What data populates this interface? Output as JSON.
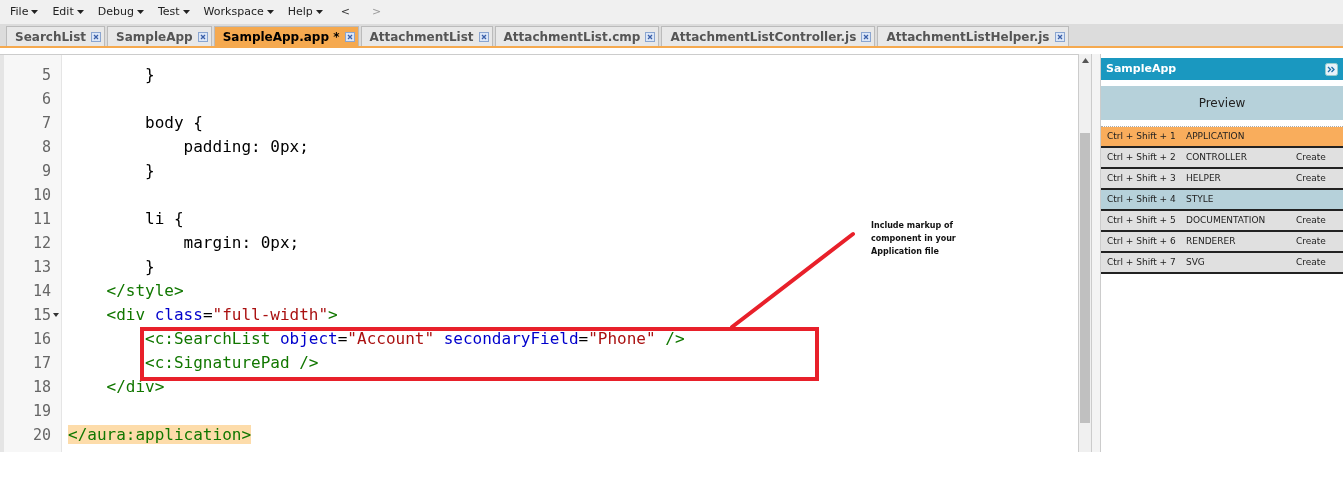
{
  "menu": [
    "File",
    "Edit",
    "Debug",
    "Test",
    "Workspace",
    "Help"
  ],
  "nav": [
    "<",
    ">"
  ],
  "tabs": [
    {
      "label": "SearchList",
      "selected": false
    },
    {
      "label": "SampleApp",
      "selected": false
    },
    {
      "label": "SampleApp.app *",
      "selected": true
    },
    {
      "label": "AttachmentList",
      "selected": false
    },
    {
      "label": "AttachmentList.cmp",
      "selected": false
    },
    {
      "label": "AttachmentListController.js",
      "selected": false
    },
    {
      "label": "AttachmentListHelper.js",
      "selected": false
    }
  ],
  "editor": {
    "lines": [
      {
        "number": "5",
        "fold": false,
        "tokens": [
          {
            "kind": "plain",
            "text": "        }"
          }
        ]
      },
      {
        "number": "6",
        "fold": false
      },
      {
        "number": "7",
        "fold": false,
        "tokens": [
          {
            "kind": "plain",
            "text": "        body {"
          }
        ]
      },
      {
        "number": "8",
        "fold": false,
        "tokens": [
          {
            "kind": "plain",
            "text": "            padding: 0px;"
          }
        ]
      },
      {
        "number": "9",
        "fold": false,
        "tokens": [
          {
            "kind": "plain",
            "text": "        }"
          }
        ]
      },
      {
        "number": "10",
        "fold": false
      },
      {
        "number": "11",
        "fold": false,
        "tokens": [
          {
            "kind": "plain",
            "text": "        li {"
          }
        ]
      },
      {
        "number": "12",
        "fold": false,
        "tokens": [
          {
            "kind": "plain",
            "text": "            margin: 0px;"
          }
        ]
      },
      {
        "number": "13",
        "fold": false,
        "tokens": [
          {
            "kind": "plain",
            "text": "        }"
          }
        ]
      },
      {
        "number": "14",
        "fold": false,
        "tokens": [
          {
            "kind": "tag",
            "text": "    </style>"
          }
        ]
      },
      {
        "number": "15",
        "fold": true,
        "tokens": [
          {
            "kind": "tag",
            "text": "    <div "
          },
          {
            "kind": "attr",
            "text": "class"
          },
          {
            "kind": "plain",
            "text": "="
          },
          {
            "kind": "string",
            "text": "\"full-width\""
          },
          {
            "kind": "tag",
            "text": ">"
          }
        ]
      },
      {
        "number": "16",
        "fold": false,
        "tokens": [
          {
            "kind": "tag",
            "text": "        <c:SearchList "
          },
          {
            "kind": "attr",
            "text": "object"
          },
          {
            "kind": "plain",
            "text": "="
          },
          {
            "kind": "string",
            "text": "\"Account\""
          },
          {
            "kind": "attr",
            "text": " secondaryField"
          },
          {
            "kind": "plain",
            "text": "="
          },
          {
            "kind": "string",
            "text": "\"Phone\""
          },
          {
            "kind": "tag",
            "text": " />"
          }
        ]
      },
      {
        "number": "17",
        "fold": false,
        "tokens": [
          {
            "kind": "tag",
            "text": "        <c:SignaturePad />"
          }
        ]
      },
      {
        "number": "18",
        "fold": false,
        "tokens": [
          {
            "kind": "tag",
            "text": "    </div>"
          }
        ]
      },
      {
        "number": "19",
        "fold": false
      },
      {
        "number": "20",
        "fold": false,
        "tokens": [
          {
            "kind": "match",
            "text": "</aura:application>"
          }
        ]
      }
    ]
  },
  "annotation": {
    "text": "Include markup of component in your Application file"
  },
  "panel": {
    "title": "SampleApp",
    "preview": "Preview",
    "rows": [
      {
        "shortcut": "Ctrl + Shift + 1",
        "name": "APPLICATION",
        "kind": "current"
      },
      {
        "shortcut": "Ctrl + Shift + 2",
        "name": "CONTROLLER",
        "kind": "missing",
        "action": "Create"
      },
      {
        "shortcut": "Ctrl + Shift + 3",
        "name": "HELPER",
        "kind": "missing",
        "action": "Create"
      },
      {
        "shortcut": "Ctrl + Shift + 4",
        "name": "STYLE",
        "kind": "exists"
      },
      {
        "shortcut": "Ctrl + Shift + 5",
        "name": "DOCUMENTATION",
        "kind": "missing",
        "action": "Create"
      },
      {
        "shortcut": "Ctrl + Shift + 6",
        "name": "RENDERER",
        "kind": "missing",
        "action": "Create"
      },
      {
        "shortcut": "Ctrl + Shift + 7",
        "name": "SVG",
        "kind": "missing",
        "action": "Create"
      }
    ]
  }
}
